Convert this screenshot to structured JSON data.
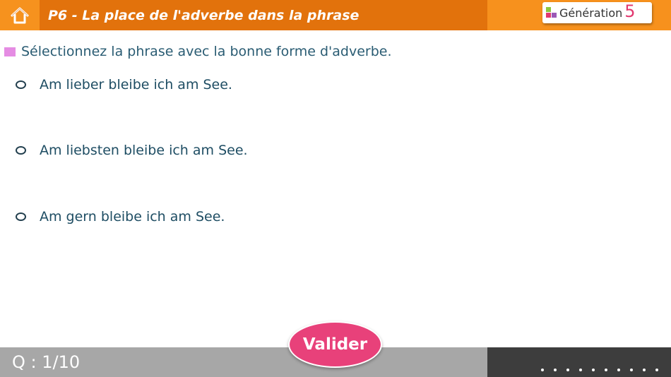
{
  "header": {
    "home_icon": "home-icon",
    "title": "P6 - La place de l'adverbe dans la phrase",
    "brand": {
      "name": "Génération",
      "number": "5"
    }
  },
  "instruction": "Sélectionnez la phrase avec la bonne forme d'adverbe.",
  "options": [
    {
      "label": "Am lieber bleibe ich am See.",
      "selected": false
    },
    {
      "label": "Am liebsten bleibe ich am See.",
      "selected": false
    },
    {
      "label": "Am gern bleibe ich am See.",
      "selected": false
    }
  ],
  "footer": {
    "question_counter": "Q : 1/10",
    "progress_steps": 10
  },
  "valider_label": "Valider",
  "colors": {
    "header_orange": "#e2720c",
    "accent_orange": "#f6921e",
    "instruction_marker": "#e58ce3",
    "text": "#1e4d63",
    "valider_pink": "#e8417a",
    "footer_gray": "#a7a7a7",
    "footer_dark": "#3d3d3d"
  }
}
